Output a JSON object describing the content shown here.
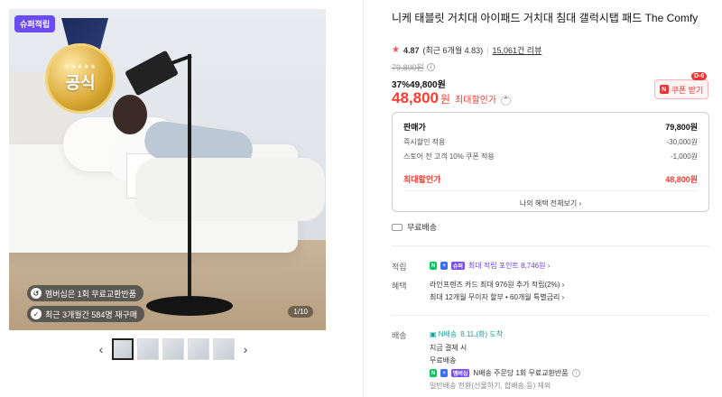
{
  "gallery": {
    "super_tag": "슈퍼적립",
    "badge_stars": "★★★★★",
    "badge_text": "공식",
    "pill1": "멤버십은 1회 무료교환반품",
    "pill2": "최근 3개월간 584명 재구매",
    "counter": "1/10",
    "prev": "‹",
    "next": "›",
    "thumb_count": 5
  },
  "product": {
    "title": "니케 태블릿 거치대 아이패드 거치대 침대 갤럭시탭 패드 The Comfy",
    "rating": "4.87",
    "rating_recent": "(최근 6개월 4.83)",
    "reviews": "15,061건 리뷰",
    "original_price": "79,800원",
    "discount_line": "37%49,800원",
    "final_price": "48,800",
    "final_unit": "원",
    "final_label": "최대할인가",
    "coupon_label": "쿠폰 받기",
    "coupon_dday": "D-6"
  },
  "pricebox": {
    "sale_label": "판매가",
    "sale_value": "79,800원",
    "instant_label": "즉시할인 적용",
    "instant_value": "-30,000원",
    "store_label": "스토어 전 고객 10% 쿠폰 적용",
    "store_value": "-1,000원",
    "max_label": "최대할인가",
    "max_value": "48,800원",
    "more": "나의 혜택 전체보기 ›"
  },
  "shipping_free": "무료배송",
  "points": {
    "label": "적립",
    "text": "최대 적립 포인트 8,746원 ›"
  },
  "benefits": {
    "label": "혜택",
    "line1": "라인프렌즈 카드 최대 976원 추가 적립(2%) ›",
    "line2": "최대 12개월 무이자 할부 • 60개월 특별금리 ›"
  },
  "delivery": {
    "label": "배송",
    "arrive": "8.11.(화) 도착",
    "line1": "지금 결제 시",
    "line2": "무료배송",
    "line3": "N배송 주문당 1회 무료교환반품",
    "line4": "일반배송 전환(선물하기, 합배송 등) 제외"
  },
  "colors": {
    "accent_red": "#ff3b30",
    "naver_green": "#03c75a",
    "purple": "#6a3ff0"
  }
}
